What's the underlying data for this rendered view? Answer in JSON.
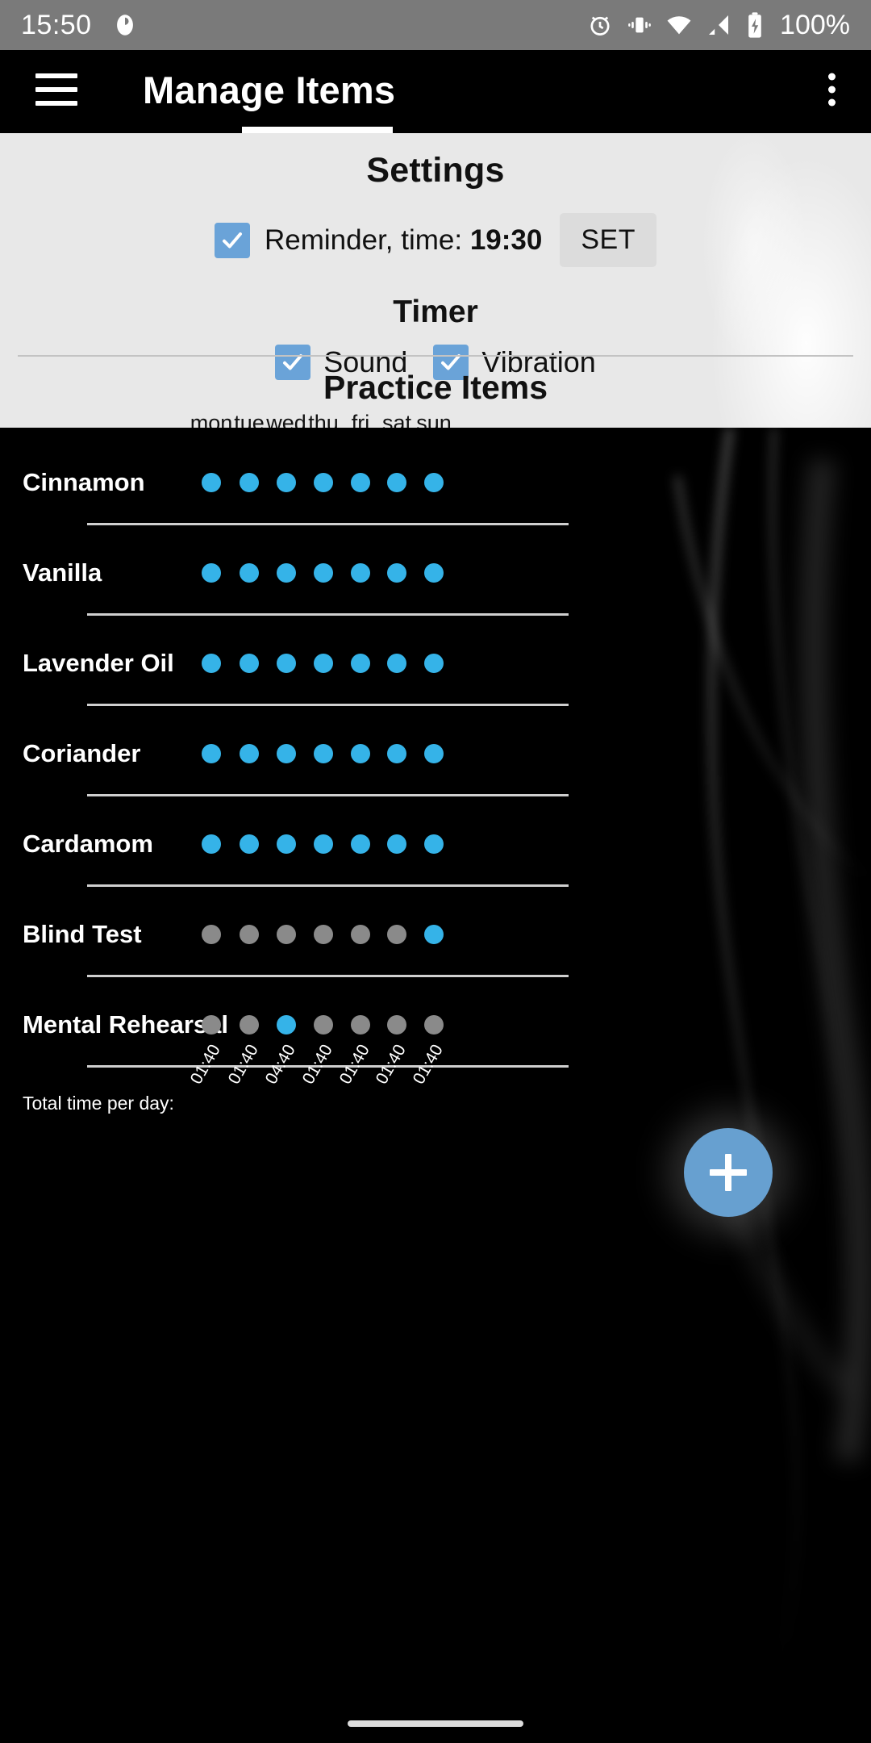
{
  "status_bar": {
    "time": "15:50",
    "battery_percent": "100%",
    "icons": [
      "profile-avatar-icon",
      "alarm-icon",
      "vibrate-icon",
      "wifi-icon",
      "cellular-signal-icon",
      "battery-charging-icon"
    ]
  },
  "app_bar": {
    "title": "Manage Items",
    "menu_icon": "hamburger-menu-icon",
    "overflow_icon": "overflow-menu-icon"
  },
  "settings": {
    "heading": "Settings",
    "reminder": {
      "checked": true,
      "label_prefix": "Reminder, time:",
      "time": "19:30",
      "button_label": "SET"
    },
    "timer": {
      "heading": "Timer",
      "sound": {
        "label": "Sound",
        "checked": true
      },
      "vibration": {
        "label": "Vibration",
        "checked": true
      }
    }
  },
  "practice": {
    "heading": "Practice Items",
    "days": [
      "mon",
      "tue",
      "wed",
      "thu",
      "fri",
      "sat",
      "sun"
    ],
    "items": [
      {
        "name": "Cinnamon",
        "days": [
          true,
          true,
          true,
          true,
          true,
          true,
          true
        ]
      },
      {
        "name": "Vanilla",
        "days": [
          true,
          true,
          true,
          true,
          true,
          true,
          true
        ]
      },
      {
        "name": "Lavender Oil",
        "days": [
          true,
          true,
          true,
          true,
          true,
          true,
          true
        ]
      },
      {
        "name": "Coriander",
        "days": [
          true,
          true,
          true,
          true,
          true,
          true,
          true
        ]
      },
      {
        "name": "Cardamom",
        "days": [
          true,
          true,
          true,
          true,
          true,
          true,
          true
        ]
      },
      {
        "name": "Blind Test",
        "days": [
          false,
          false,
          false,
          false,
          false,
          false,
          true
        ]
      },
      {
        "name": "Mental Rehearsal",
        "days": [
          false,
          false,
          true,
          false,
          false,
          false,
          false
        ]
      }
    ],
    "total_label": "Total time per day:",
    "totals": [
      "01:40",
      "01:40",
      "04:40",
      "01:40",
      "01:40",
      "01:40",
      "01:40"
    ]
  },
  "fab": {
    "icon": "plus-icon",
    "label": "+"
  },
  "colors": {
    "accent_dot_on": "#35b3e8",
    "accent_dot_off": "#8a8a8a",
    "checkbox": "#6aa3d8",
    "fab": "#67a0d0",
    "settings_bg": "#e8e8e8",
    "status_bar_bg": "#7a7a7a"
  }
}
